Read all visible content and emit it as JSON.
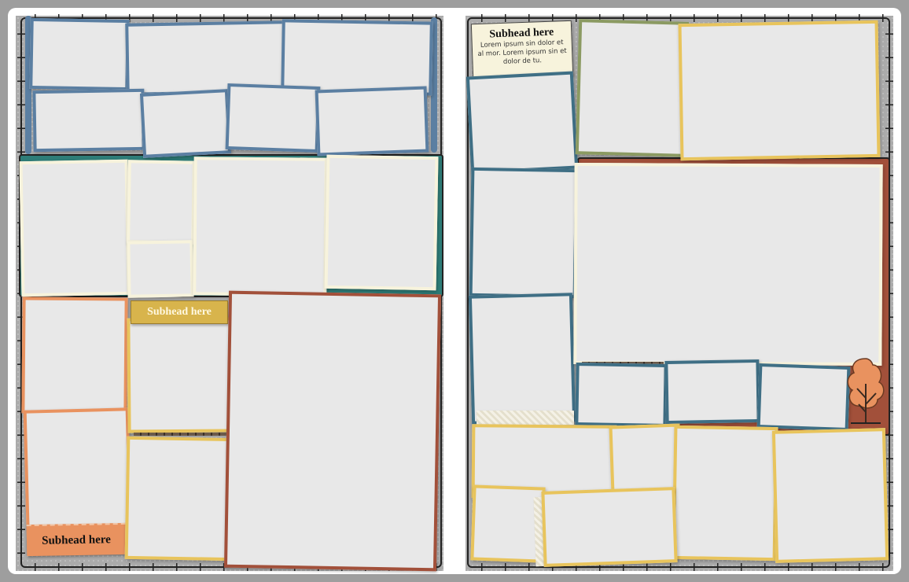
{
  "layout": {
    "left_page": {
      "subhead_yellow": "Subhead here",
      "subhead_orange": "Subhead here"
    },
    "right_page": {
      "text_card": {
        "heading": "Subhead here",
        "body": "Lorem ipsum sin dolor et al mor. Lorem ipsum sin et dolor de tu."
      }
    }
  },
  "colors": {
    "background": "#9e9e9e",
    "page": "#ababab",
    "blue": "#5b7fa2",
    "teal": "#2e7d78",
    "cream": "#f7f3dc",
    "orange": "#e9925f",
    "rust": "#a2503a",
    "yellow": "#e8c45c",
    "tree": "#e9925f"
  },
  "icons": [
    "tree-icon",
    "bead-garland",
    "twig-border"
  ]
}
